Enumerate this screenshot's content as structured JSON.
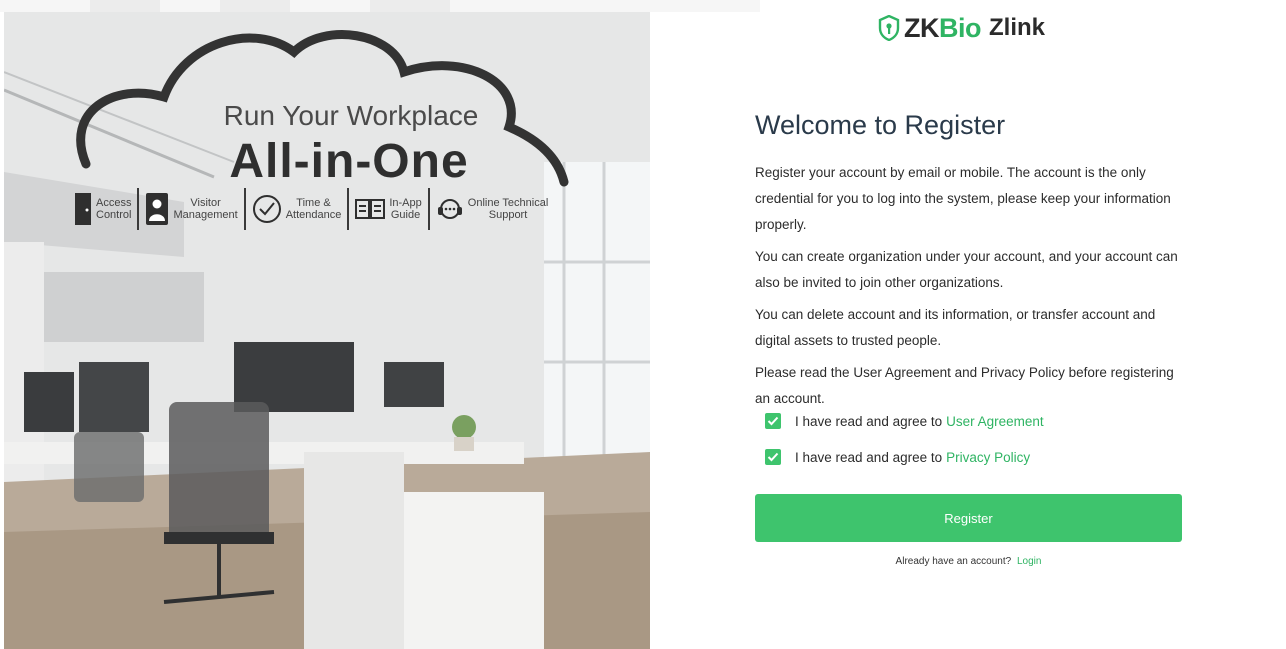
{
  "hero": {
    "headline_line1": "Run Your Workplace",
    "headline_line2": "All-in-One",
    "features": [
      {
        "icon": "door-icon",
        "label_line1": "Access",
        "label_line2": "Control"
      },
      {
        "icon": "visitor-icon",
        "label_line1": "Visitor",
        "label_line2": "Management"
      },
      {
        "icon": "clock-icon",
        "label_line1": "Time &",
        "label_line2": "Attendance"
      },
      {
        "icon": "book-icon",
        "label_line1": "In-App",
        "label_line2": "Guide"
      },
      {
        "icon": "headset-icon",
        "label_line1": "Online Technical",
        "label_line2": "Support"
      }
    ]
  },
  "brand": {
    "logo_zk": "ZK",
    "logo_bio": "Bio",
    "logo_product": "Zlink",
    "accent_color": "#3ec46d"
  },
  "register": {
    "title": "Welcome to Register",
    "paragraphs": [
      "Register your account by email or mobile. The account is the only credential for you to log into the system, please keep your information properly.",
      "You can create organization under your account, and your account can also be invited to join other organizations.",
      "You can delete account and its information, or transfer account and digital assets to trusted people.",
      "Please read the User Agreement and Privacy Policy before registering an account."
    ],
    "agreements": [
      {
        "text": "I have read and agree to",
        "link": "User Agreement",
        "checked": true
      },
      {
        "text": "I have read and agree to",
        "link": "Privacy Policy",
        "checked": true
      }
    ],
    "button_label": "Register",
    "login_prompt": "Already have an account?",
    "login_link": "Login"
  }
}
